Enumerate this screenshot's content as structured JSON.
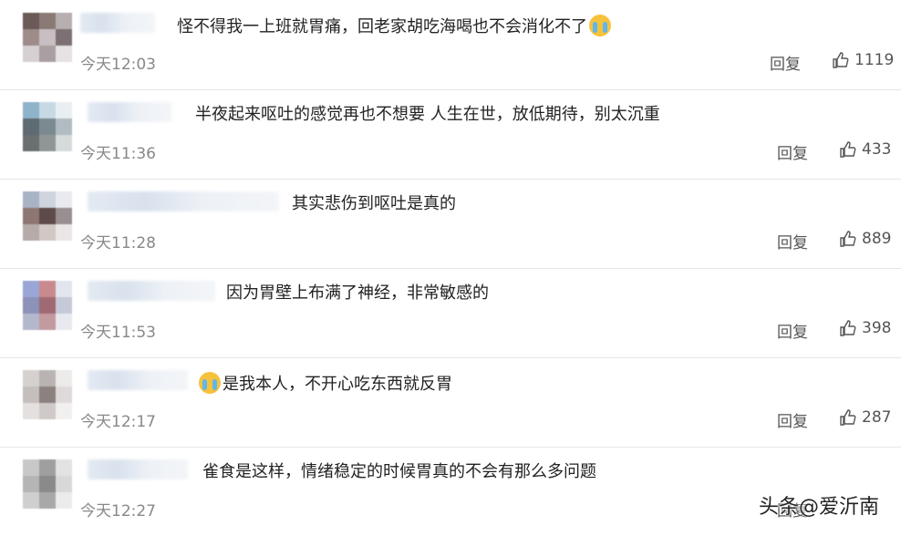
{
  "comments": [
    {
      "text": "怪不得我一上班就胃痛，回老家胡吃海喝也不会消化不了",
      "time": "今天12:03",
      "reply": "回复",
      "likes": "1119",
      "emoji": "crying-face"
    },
    {
      "text": "半夜起来呕吐的感觉再也不想要 人生在世，放低期待，别太沉重",
      "time": "今天11:36",
      "reply": "回复",
      "likes": "433"
    },
    {
      "text": "其实悲伤到呕吐是真的",
      "time": "今天11:28",
      "reply": "回复",
      "likes": "889"
    },
    {
      "text": "因为胃壁上布满了神经，非常敏感的",
      "time": "今天11:53",
      "reply": "回复",
      "likes": "398"
    },
    {
      "text": "是我本人，不开心吃东西就反胃",
      "time": "今天12:17",
      "reply": "回复",
      "likes": "287",
      "emoji": "crying-face"
    },
    {
      "text": "雀食是这样，情绪稳定的时候胃真的不会有那么多问题",
      "time": "今天12:27",
      "reply": "回复",
      "likes": ""
    }
  ],
  "watermark": "头条@爱沂南",
  "colors": {
    "text": "#222222",
    "time": "#888888",
    "divider": "#e6e6e6",
    "emoji": "#f7c23b"
  }
}
